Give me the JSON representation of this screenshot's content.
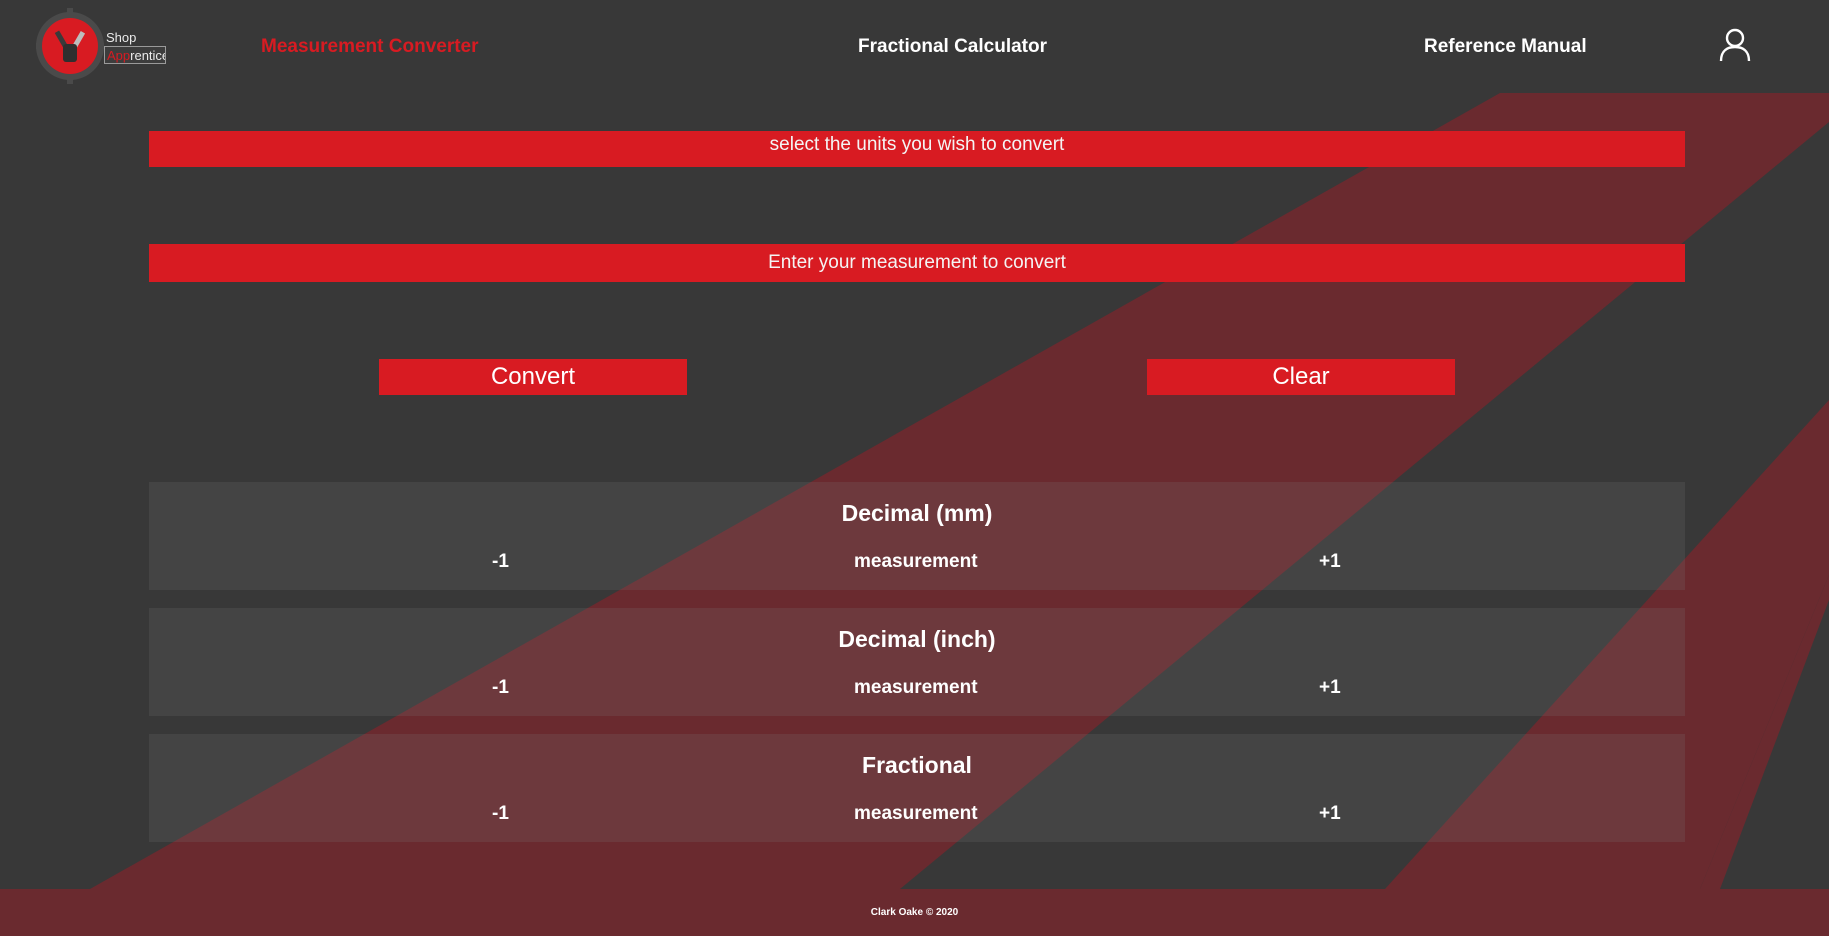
{
  "app": {
    "logo_line1": "Shop",
    "logo_line2_accent": "App",
    "logo_line2_rest": "rentice",
    "logo_icon": "gear-wrench-fist-icon"
  },
  "nav": {
    "items": [
      {
        "label": "Measurement Converter",
        "active": true
      },
      {
        "label": "Fractional Calculator",
        "active": false
      },
      {
        "label": "Reference Manual",
        "active": false
      }
    ],
    "profile_icon": "user-icon"
  },
  "converter": {
    "units_prompt": "select the units you wish to convert",
    "input_prompt": "Enter your measurement to convert",
    "convert_label": "Convert",
    "clear_label": "Clear"
  },
  "results": [
    {
      "title": "Decimal (mm)",
      "minus": "-1",
      "value": "measurement",
      "plus": "+1"
    },
    {
      "title": "Decimal (inch)",
      "minus": "-1",
      "value": "measurement",
      "plus": "+1"
    },
    {
      "title": "Fractional",
      "minus": "-1",
      "value": "measurement",
      "plus": "+1"
    }
  ],
  "footer": {
    "text": "Clark Oake © 2020"
  },
  "colors": {
    "accent": "#d81b22",
    "background": "#383838",
    "stripe": "#6a2a2f",
    "footer": "#6a2a2f"
  }
}
